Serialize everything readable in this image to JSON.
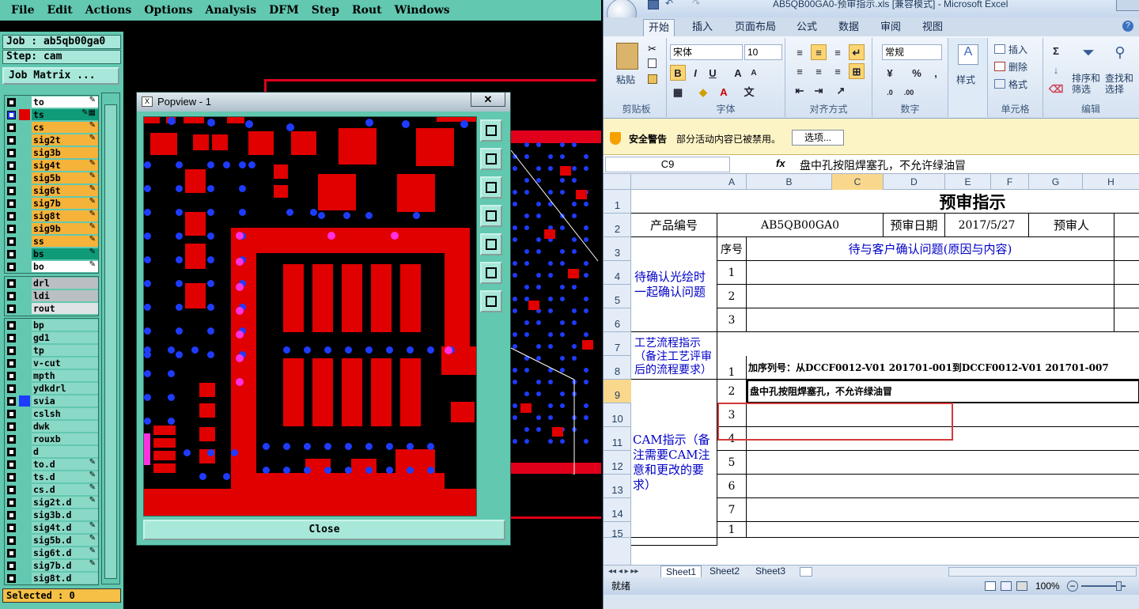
{
  "cam": {
    "menu": [
      "File",
      "Edit",
      "Actions",
      "Options",
      "Analysis",
      "DFM",
      "Step",
      "Rout",
      "Windows"
    ],
    "job_label": "Job : ab5qb00ga0",
    "step_label": "Step: cam",
    "job_matrix_button": "Job Matrix ...",
    "layers_group1": [
      {
        "name": "to",
        "color": "#ffffff",
        "marker": "✎"
      },
      {
        "name": "ts",
        "color": "#0f9a78",
        "marker": "✎▦"
      },
      {
        "name": "cs",
        "color": "#f5b33a",
        "marker": "✎"
      },
      {
        "name": "sig2t",
        "color": "#f5b33a",
        "marker": "✎"
      },
      {
        "name": "sig3b",
        "color": "#f5b33a",
        "marker": ""
      },
      {
        "name": "sig4t",
        "color": "#f5b33a",
        "marker": "✎"
      },
      {
        "name": "sig5b",
        "color": "#f5b33a",
        "marker": "✎"
      },
      {
        "name": "sig6t",
        "color": "#f5b33a",
        "marker": "✎"
      },
      {
        "name": "sig7b",
        "color": "#f5b33a",
        "marker": "✎"
      },
      {
        "name": "sig8t",
        "color": "#f5b33a",
        "marker": "✎"
      },
      {
        "name": "sig9b",
        "color": "#f5b33a",
        "marker": "✎"
      },
      {
        "name": "ss",
        "color": "#f5b33a",
        "marker": "✎"
      },
      {
        "name": "bs",
        "color": "#0f9a78",
        "marker": "✎"
      },
      {
        "name": "bo",
        "color": "#ffffff",
        "marker": "✎"
      }
    ],
    "layers_group2": [
      {
        "name": "drl",
        "color": "#b9bfc2",
        "marker": ""
      },
      {
        "name": "ldi",
        "color": "#b9bfc2",
        "marker": ""
      },
      {
        "name": "rout",
        "color": "#dfe3e5",
        "marker": ""
      }
    ],
    "layers_group3": [
      {
        "name": "bp",
        "marker": ""
      },
      {
        "name": "gd1",
        "marker": ""
      },
      {
        "name": "tp",
        "marker": ""
      },
      {
        "name": "v-cut",
        "marker": ""
      },
      {
        "name": "mpth",
        "marker": ""
      },
      {
        "name": "ydkdrl",
        "marker": ""
      },
      {
        "name": "svia",
        "marker": ""
      },
      {
        "name": "cslsh",
        "marker": ""
      },
      {
        "name": "dwk",
        "marker": ""
      },
      {
        "name": "rouxb",
        "marker": ""
      },
      {
        "name": "d",
        "marker": ""
      },
      {
        "name": "to.d",
        "marker": "✎"
      },
      {
        "name": "ts.d",
        "marker": "✎"
      },
      {
        "name": "cs.d",
        "marker": "✎"
      },
      {
        "name": "sig2t.d",
        "marker": "✎"
      },
      {
        "name": "sig3b.d",
        "marker": ""
      },
      {
        "name": "sig4t.d",
        "marker": "✎"
      },
      {
        "name": "sig5b.d",
        "marker": "✎"
      },
      {
        "name": "sig6t.d",
        "marker": "✎"
      },
      {
        "name": "sig7b.d",
        "marker": "✎"
      },
      {
        "name": "sig8t.d",
        "marker": ""
      }
    ],
    "active_swatches": {
      "ts": "#e00000",
      "svia": "#1e3cff"
    },
    "selected_label": "Selected : 0",
    "popview": {
      "title": "Popview - 1",
      "close_x": "✕",
      "close_button": "Close"
    },
    "colors": {
      "panel": "#62c8b0",
      "copper": "#e00000",
      "via": "#1e3cff",
      "pad": "#ff30e0"
    }
  },
  "excel": {
    "title": "AB5QB00GA0-预审指示.xls  [兼容模式] - Microsoft Excel",
    "tabs": [
      "开始",
      "插入",
      "页面布局",
      "公式",
      "数据",
      "审阅",
      "视图"
    ],
    "active_tab": "开始",
    "ribbon": {
      "paste": "粘贴",
      "clipboard": "剪贴板",
      "font_name": "宋体",
      "font_size": "10",
      "font_group": "字体",
      "align_group": "对齐方式",
      "number_format": "常规",
      "number_group": "数字",
      "styles": "样式",
      "insert": "插入",
      "delete": "删除",
      "format": "格式",
      "cells_group": "单元格",
      "sort_filter": "排序和\n筛选",
      "find_select": "查找和\n选择",
      "edit_group": "编辑"
    },
    "security": {
      "title": "安全警告",
      "message": "部分活动内容已被禁用。",
      "options": "选项..."
    },
    "name_box": "C9",
    "fx": "fx",
    "formula": "盘中孔按阻焊塞孔，不允许绿油冒",
    "columns": [
      "A",
      "B",
      "C",
      "D",
      "E",
      "F",
      "G",
      "H"
    ],
    "rows": [
      "1",
      "2",
      "3",
      "4",
      "5",
      "6",
      "7",
      "8",
      "9",
      "10",
      "11",
      "12",
      "13",
      "14",
      "15"
    ],
    "sheet": {
      "title": "预审指示",
      "product_no_label": "产品编号",
      "product_no": "AB5QB00GA0",
      "review_date_label": "预审日期",
      "review_date": "2017/5/27",
      "reviewer_label": "预审人",
      "seq_label": "序号",
      "confirm_header": "待与客户确认问题(原因与内容)",
      "confirm_section": "待确认光绘时一起确认问题",
      "confirm_nums": [
        "1",
        "2",
        "3"
      ],
      "process_section": "工艺流程指示（备注工艺评审后的流程要求）",
      "cam_section": "CAM指示（备注需要CAM注意和更改的要求）",
      "cam_nums": [
        "1",
        "2",
        "3",
        "4",
        "5",
        "6",
        "7",
        "1"
      ],
      "cam_row1": "加序列号：从DCCF0012-V01 201701-001到DCCF0012-V01 201701-007",
      "cam_row2": "盘中孔按阻焊塞孔，不允许绿油冒"
    },
    "sheet_tabs": [
      "Sheet1",
      "Sheet2",
      "Sheet3"
    ],
    "status": "就绪",
    "zoom": "100%"
  }
}
